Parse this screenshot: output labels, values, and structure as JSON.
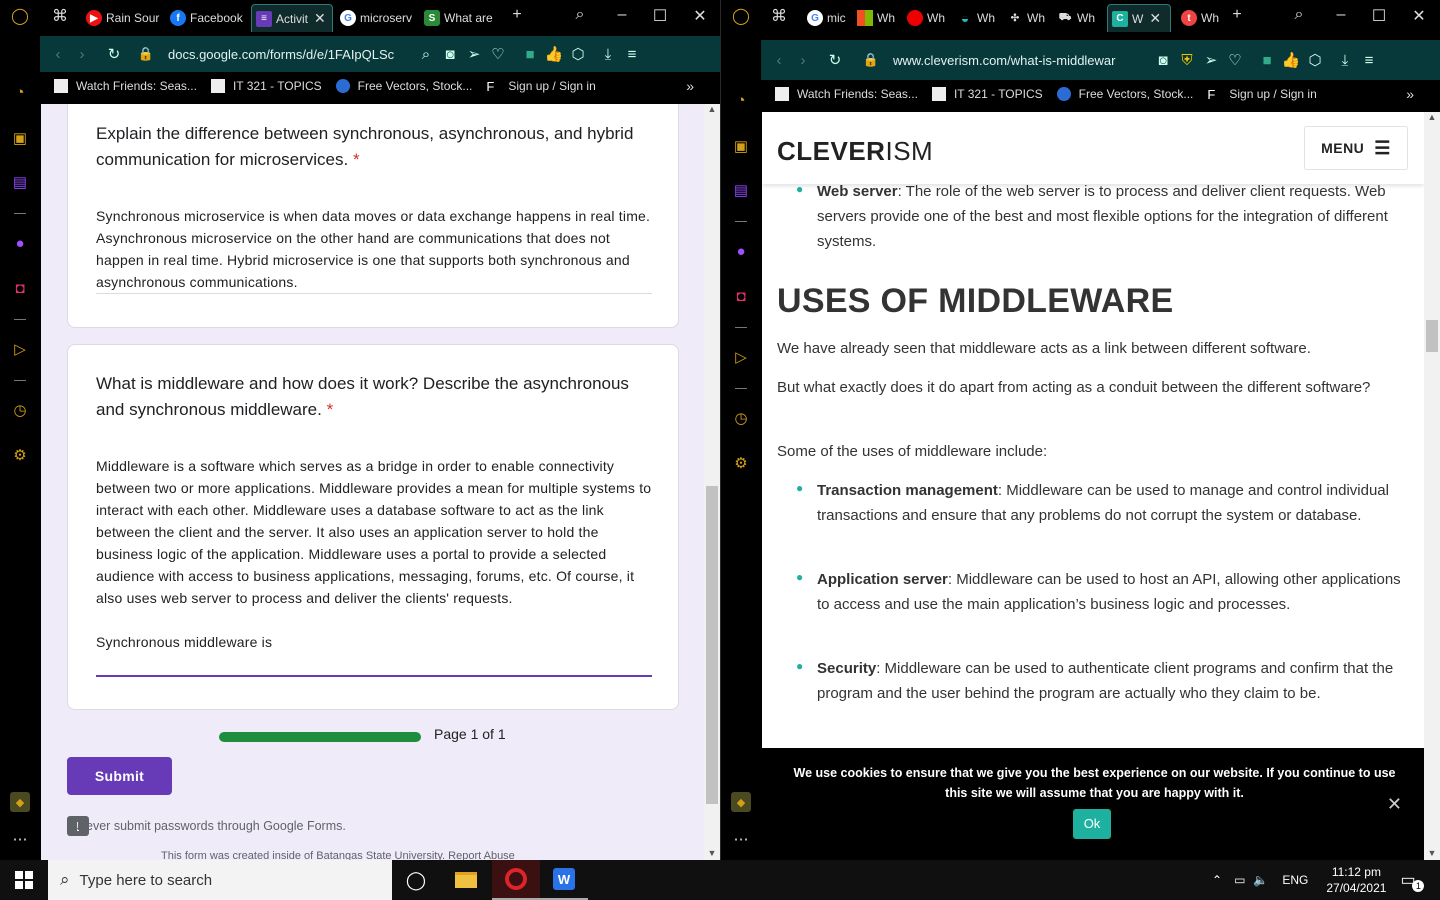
{
  "left_browser": {
    "tabs": [
      "Rain Sour",
      "Facebook",
      "Activit",
      "microserv",
      "What are"
    ],
    "url": "docs.google.com/forms/d/e/1FAIpQLSc",
    "bookmarks": [
      "Watch Friends: Seas...",
      "IT 321 - TOPICS",
      "Free Vectors, Stock...",
      "Sign up / Sign in"
    ]
  },
  "right_browser": {
    "tabs": [
      "mic",
      "Wh",
      "Wh",
      "Wh",
      "Wh",
      "Wh",
      "W",
      "Wh"
    ],
    "url": "www.cleverism.com/what-is-middlewar",
    "bookmarks": [
      "Watch Friends: Seas...",
      "IT 321 - TOPICS",
      "Free Vectors, Stock...",
      "Sign up / Sign in"
    ]
  },
  "form": {
    "q1": {
      "title": "Explain the difference between synchronous, asynchronous, and hybrid communication for microservices.",
      "required": "*",
      "answer": "Synchronous microservice is when data moves or data exchange happens in real time. Asynchronous microservice on the other hand are communications that does not happen in real time. Hybrid microservice is one that supports both synchronous and asynchronous communications."
    },
    "q2": {
      "title": "What is middleware and how does it work? Describe the asynchronous and synchronous middleware.",
      "required": "*",
      "answer": "Middleware is a software which serves as a bridge in order to enable connectivity between two or more applications. Middleware provides a mean for multiple systems to interact with each other. Middleware uses a database software to act as the link between the client and the server. It also uses an application server to hold the business logic of the application. Middleware uses a portal to provide a selected audience with access to business applications, messaging, forums, etc. Of course, it also uses web server to process and deliver the clients' requests.",
      "answer2": "Synchronous middleware is"
    },
    "progress": 1.0,
    "page_label": "Page 1 of 1",
    "submit": "Submit",
    "never": "Never submit passwords through Google Forms.",
    "created": "This form was created inside of Batangas State University. Report Abuse"
  },
  "cleverism": {
    "logo_bold": "CLEVER",
    "logo_light": "ISM",
    "menu": "MENU",
    "web_server_term": "Web server",
    "web_server_text": ": The role of the web server is to process and deliver client requests. Web servers provide one of the best and most flexible options for the integration of different systems.",
    "heading": "USES OF MIDDLEWARE",
    "p1": "We have already seen that middleware acts as a link between different software.",
    "p2": "But what exactly does it do apart from acting as a conduit between the different software?",
    "p3": "Some of the uses of middleware include:",
    "items": [
      {
        "term": "Transaction management",
        "text": ": Middleware can be used to manage and control individual transactions and ensure that any problems do not corrupt the system or database."
      },
      {
        "term": "Application server",
        "text": ": Middleware can be used to host an API, allowing other applications to access and use the main application’s business logic and processes."
      },
      {
        "term": "Security",
        "text": ": Middleware can be used to authenticate client programs and confirm that the program and the user behind the program are actually who they claim to be."
      }
    ],
    "cookie": "We use cookies to ensure that we give you the best experience on our website. If you continue to use this site we will assume that you are happy with it.",
    "cookie_ok": "Ok"
  },
  "taskbar": {
    "search_placeholder": "Type here to search",
    "lang": "ENG",
    "time": "11:12 pm",
    "date": "27/04/2021",
    "notif_count": "1"
  },
  "colors": {
    "accent_purple": "#673ab7",
    "teal": "#1fb19f",
    "toolbar": "#07393b"
  }
}
